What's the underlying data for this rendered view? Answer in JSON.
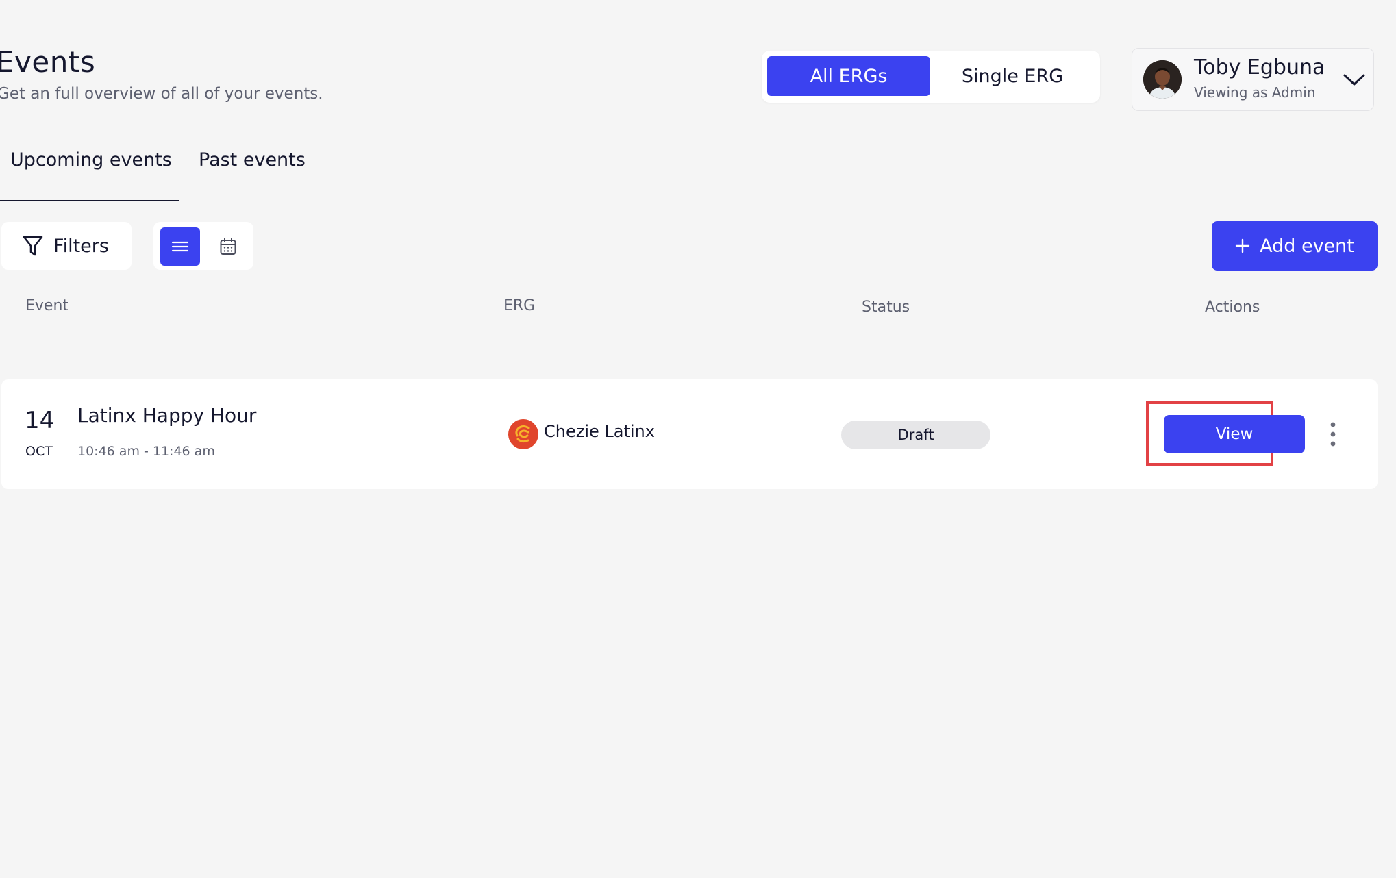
{
  "header": {
    "title": "Events",
    "subtitle": "Get an full overview of all of your events."
  },
  "erg_toggle": {
    "options": [
      "All ERGs",
      "Single ERG"
    ],
    "selected": "All ERGs"
  },
  "user": {
    "name": "Toby Egbuna",
    "role": "Viewing as Admin",
    "avatar_icon": "user-avatar-photo"
  },
  "tabs": [
    {
      "label": "Upcoming events",
      "active": true
    },
    {
      "label": "Past events",
      "active": false
    }
  ],
  "toolbar": {
    "filters_label": "Filters",
    "filters_icon": "funnel-icon",
    "view_modes": [
      {
        "name": "list-icon",
        "active": true
      },
      {
        "name": "calendar-icon",
        "active": false
      }
    ],
    "add_label": "Add event",
    "add_icon": "plus-icon"
  },
  "table": {
    "columns": [
      "Event",
      "ERG",
      "Status",
      "Actions"
    ],
    "rows": [
      {
        "day": "14",
        "month": "OCT",
        "name": "Latinx Happy Hour",
        "time": "10:46 am - 11:46 am",
        "erg": "Chezie Latinx",
        "erg_icon": "erg-logo-icon",
        "status": "Draft",
        "action_label": "View",
        "more_icon": "kebab-menu-icon"
      }
    ]
  },
  "colors": {
    "primary": "#3b42f0",
    "background": "#f5f5f5",
    "text": "#15172e",
    "muted": "#5d6070",
    "highlight": "#e24145",
    "erg_logo_bg": "#e0452c",
    "erg_logo_fg": "#f6b32b"
  }
}
